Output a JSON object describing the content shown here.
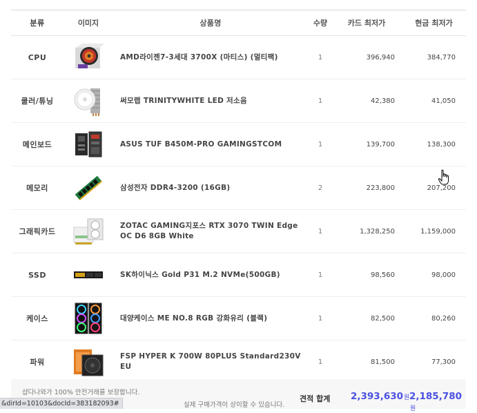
{
  "header": {
    "category": "분류",
    "image": "이미지",
    "name": "상품명",
    "qty": "수량",
    "card_price": "카드 최저가",
    "cash_price": "현금 최저가"
  },
  "items": [
    {
      "category": "CPU",
      "name": "AMD라이젠7-3세대 3700X (마티스) (멀티팩)",
      "qty": "1",
      "card": "396,940",
      "cash": "384,770",
      "icon": "cpu-box-icon"
    },
    {
      "category": "쿨러/튜닝",
      "name": "써모랩 TRINITYWHITE LED 저소음",
      "qty": "1",
      "card": "42,380",
      "cash": "41,050",
      "icon": "cpu-cooler-icon"
    },
    {
      "category": "메인보드",
      "name": "ASUS TUF B450M-PRO GAMINGSTCOM",
      "qty": "1",
      "card": "139,700",
      "cash": "138,300",
      "icon": "motherboard-icon"
    },
    {
      "category": "메모리",
      "name": "삼성전자 DDR4-3200 (16GB)",
      "qty": "2",
      "card": "223,800",
      "cash": "207,200",
      "icon": "ram-stick-icon"
    },
    {
      "category": "그래픽카드",
      "name": "ZOTAC GAMING지포스 RTX 3070 TWIN Edge OC D6 8GB White",
      "qty": "1",
      "card": "1,328,250",
      "cash": "1,159,000",
      "icon": "graphics-card-icon"
    },
    {
      "category": "SSD",
      "name": "SK하이닉스 Gold P31 M.2 NVMe(500GB)",
      "qty": "1",
      "card": "98,560",
      "cash": "98,000",
      "icon": "ssd-icon"
    },
    {
      "category": "케이스",
      "name": "대양케이스 ME NO.8 RGB 강화유리 (블랙)",
      "qty": "1",
      "card": "82,500",
      "cash": "80,260",
      "icon": "pc-case-icon"
    },
    {
      "category": "파워",
      "name": "FSP HYPER K 700W 80PLUS Standard230V EU",
      "qty": "1",
      "card": "81,500",
      "cash": "77,300",
      "icon": "power-supply-icon"
    }
  ],
  "footer": {
    "notice_line1": "샵다나와가 100% 안전거래를 보장합니다.",
    "notice_line2": "실제 구매가격이 상이할 수 있습니다.",
    "total_label": "견적 합계",
    "total_card": "2,393,630",
    "total_cash": "2,185,780",
    "currency": "원"
  },
  "status_bar": {
    "url": "&dirId=10103&docId=383182093#"
  },
  "colors": {
    "accent": "#4a50e0"
  }
}
